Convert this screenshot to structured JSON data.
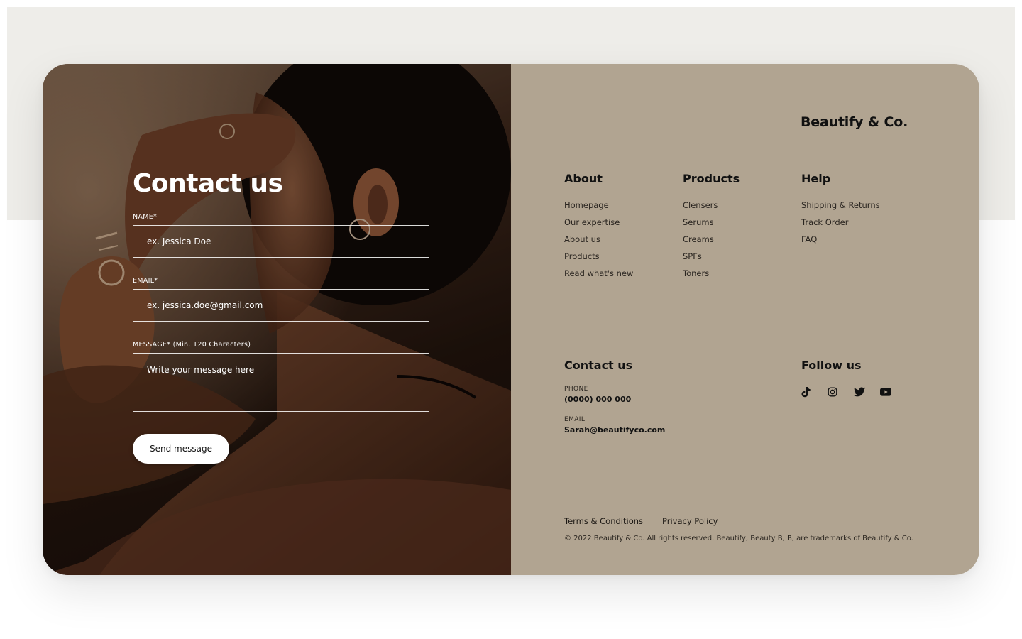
{
  "form": {
    "title": "Contact us",
    "name_label": "NAME*",
    "name_placeholder": "ex. Jessica Doe",
    "email_label": "EMAIL*",
    "email_placeholder": "ex. jessica.doe@gmail.com",
    "message_label": "MESSAGE*",
    "message_hint": " (Min. 120 Characters)",
    "message_placeholder": "Write your message here",
    "send_label": "Send message"
  },
  "footer": {
    "brand": "Beautify & Co.",
    "about": {
      "title": "About",
      "links": [
        "Homepage",
        "Our expertise",
        "About us",
        "Products",
        "Read what's new"
      ]
    },
    "products": {
      "title": "Products",
      "links": [
        "Clensers",
        "Serums",
        "Creams",
        "SPFs",
        "Toners"
      ]
    },
    "help": {
      "title": "Help",
      "links": [
        "Shipping & Returns",
        "Track Order",
        "FAQ"
      ]
    },
    "contact": {
      "title": "Contact us",
      "phone_label": "PHONE",
      "phone": "(0000) 000 000",
      "email_label": "EMAIL",
      "email": "Sarah@beautifyco.com"
    },
    "follow": {
      "title": "Follow us",
      "icons": [
        "tiktok-icon",
        "instagram-icon",
        "twitter-icon",
        "youtube-icon"
      ]
    },
    "terms": "Terms & Conditions",
    "privacy": "Privacy Policy",
    "copyright": "© 2022 Beautify & Co. All rights reserved. Beautify, Beauty B, B, are trademarks of Beautify & Co."
  },
  "colors": {
    "panel": "#b1a491",
    "band": "#eeede9",
    "text": "#111111",
    "button_bg": "#ffffff"
  }
}
